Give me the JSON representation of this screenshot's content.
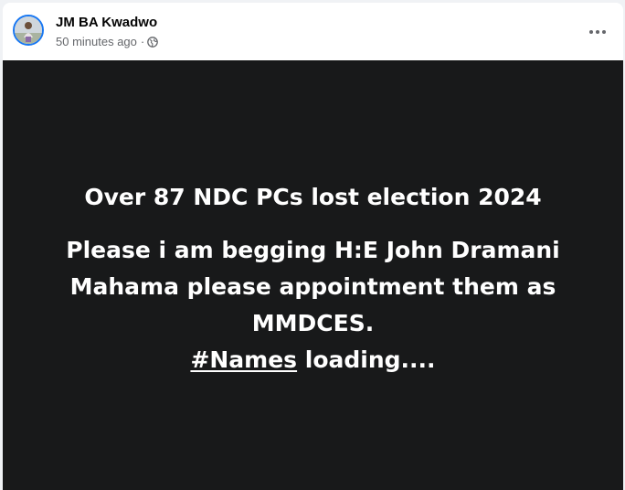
{
  "post": {
    "author": "JM BA Kwadwo",
    "time": "50 minutes ago",
    "separator": "·",
    "privacy_icon": "globe-icon",
    "more_icon": "more-options-icon"
  },
  "content": {
    "headline": "Over 87 NDC PCs lost election 2024",
    "lines": [
      "Please i am begging H:E John Dramani",
      "Mahama please appointment them as",
      "MMDCES."
    ],
    "hashtag": "#Names",
    "trailing": " loading...."
  },
  "colors": {
    "background": "#18191a",
    "text": "#ffffff",
    "avatar_ring": "#1877f2",
    "meta": "#65676b"
  }
}
